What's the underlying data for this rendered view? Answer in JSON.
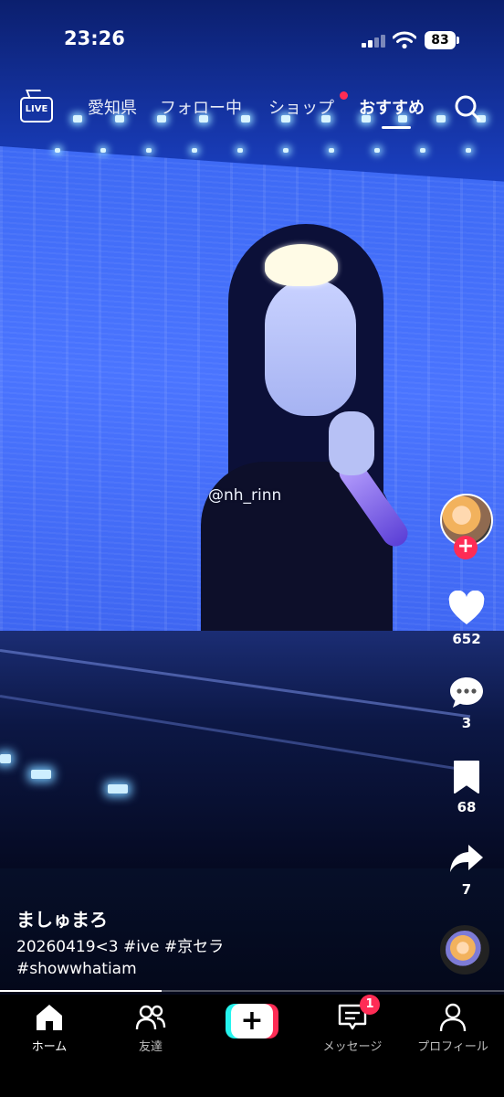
{
  "status_bar": {
    "time": "23:26",
    "battery": "83"
  },
  "top_nav": {
    "live_label": "LIVE",
    "tabs": [
      {
        "label": "愛知県"
      },
      {
        "label": "フォロー中"
      },
      {
        "label": "ショップ"
      },
      {
        "label": "おすすめ"
      }
    ],
    "active_tab": "おすすめ",
    "shop_has_dot": true,
    "icons": [
      "live-icon",
      "search-icon"
    ]
  },
  "video": {
    "watermark": "@nh_rinn"
  },
  "right_rail": {
    "follow_icon": "plus-icon",
    "likes": "652",
    "comments": "3",
    "saves": "68",
    "shares": "7"
  },
  "post": {
    "username": "ましゅまろ",
    "caption_line1": "20260419<3 #ive #京セラ",
    "caption_line2": "#showwhatiam",
    "progress": 0.32
  },
  "bottom_nav": {
    "items": [
      {
        "label": "ホーム",
        "icon": "home-icon"
      },
      {
        "label": "友達",
        "icon": "friends-icon"
      },
      {
        "label": "",
        "icon": "create-plus-icon"
      },
      {
        "label": "メッセージ",
        "icon": "inbox-icon"
      },
      {
        "label": "プロフィール",
        "icon": "profile-icon"
      }
    ],
    "inbox_badge": "1"
  },
  "colors": {
    "accent_red": "#fe2c55",
    "accent_cyan": "#25f4ee"
  }
}
